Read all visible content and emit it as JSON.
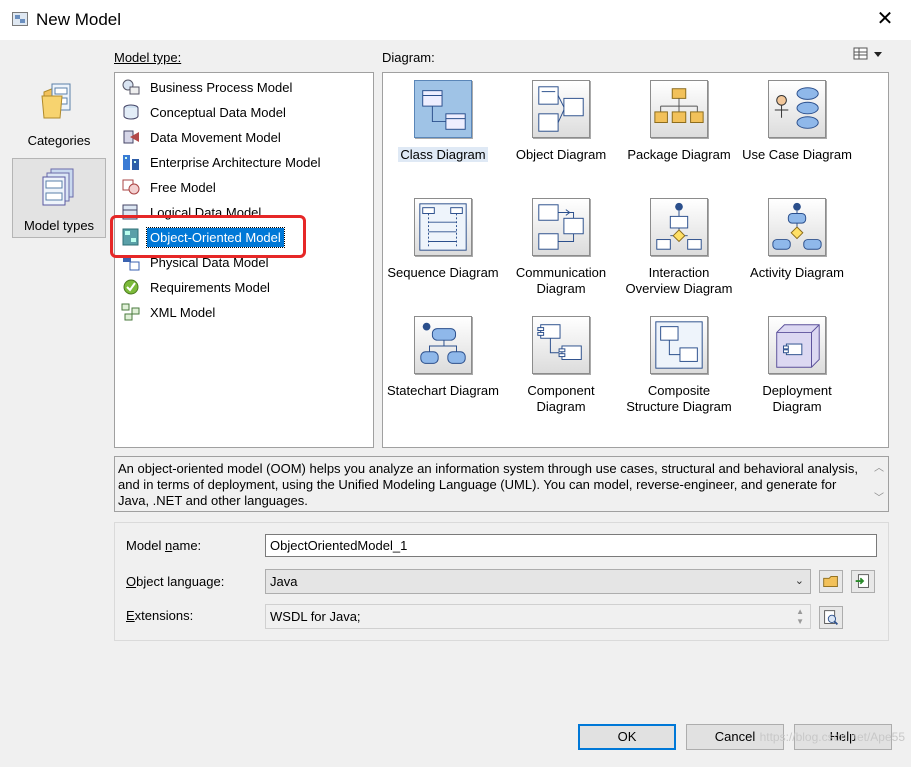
{
  "window": {
    "title": "New Model",
    "close_glyph": "✕",
    "app_icon": "model-window-icon"
  },
  "sidebar": {
    "categories_label": "Categories",
    "model_types_label": "Model types",
    "selected": "Model types"
  },
  "model_type": {
    "label": "Model type:",
    "items": [
      {
        "label": "Business Process Model",
        "icon": "business-process-icon"
      },
      {
        "label": "Conceptual Data Model",
        "icon": "conceptual-data-icon"
      },
      {
        "label": "Data Movement Model",
        "icon": "data-movement-icon"
      },
      {
        "label": "Enterprise Architecture Model",
        "icon": "enterprise-architecture-icon"
      },
      {
        "label": "Free Model",
        "icon": "free-model-icon"
      },
      {
        "label": "Logical Data Model",
        "icon": "logical-data-icon"
      },
      {
        "label": "Object-Oriented Model",
        "icon": "object-oriented-icon"
      },
      {
        "label": "Physical Data Model",
        "icon": "physical-data-icon"
      },
      {
        "label": "Requirements Model",
        "icon": "requirements-icon"
      },
      {
        "label": "XML Model",
        "icon": "xml-model-icon"
      }
    ],
    "selected": "Object-Oriented Model"
  },
  "diagram": {
    "label": "Diagram:",
    "items": [
      {
        "label": "Class Diagram",
        "icon": "class-diagram-icon"
      },
      {
        "label": "Object Diagram",
        "icon": "object-diagram-icon"
      },
      {
        "label": "Package Diagram",
        "icon": "package-diagram-icon"
      },
      {
        "label": "Use Case Diagram",
        "icon": "use-case-diagram-icon"
      },
      {
        "label": "Sequence Diagram",
        "icon": "sequence-diagram-icon"
      },
      {
        "label": "Communication Diagram",
        "icon": "communication-diagram-icon"
      },
      {
        "label": "Interaction Overview Diagram",
        "icon": "interaction-overview-icon"
      },
      {
        "label": "Activity Diagram",
        "icon": "activity-diagram-icon"
      },
      {
        "label": "Statechart Diagram",
        "icon": "statechart-diagram-icon"
      },
      {
        "label": "Component Diagram",
        "icon": "component-diagram-icon"
      },
      {
        "label": "Composite Structure Diagram",
        "icon": "composite-structure-icon"
      },
      {
        "label": "Deployment Diagram",
        "icon": "deployment-diagram-icon"
      }
    ],
    "selected": "Class Diagram"
  },
  "description": "An object-oriented model (OOM) helps you analyze an information system through use cases, structural and behavioral analysis, and in terms of deployment, using the Unified Modeling Language (UML). You can model, reverse-engineer, and generate for Java, .NET and other languages.",
  "form": {
    "model_name": {
      "label_pre": "Model ",
      "label_u": "n",
      "label_post": "ame:",
      "value": "ObjectOrientedModel_1"
    },
    "object_language": {
      "label_pre": "",
      "label_u": "O",
      "label_post": "bject language:",
      "value": "Java"
    },
    "extensions": {
      "label_pre": "",
      "label_u": "E",
      "label_post": "xtensions:",
      "value": "WSDL for Java;"
    }
  },
  "buttons": {
    "ok": "OK",
    "cancel": "Cancel",
    "help": "Help"
  },
  "watermark": "https://blog.csdn.net/Ape55",
  "colors": {
    "selection": "#0078d7",
    "highlight_box": "#e62727"
  }
}
